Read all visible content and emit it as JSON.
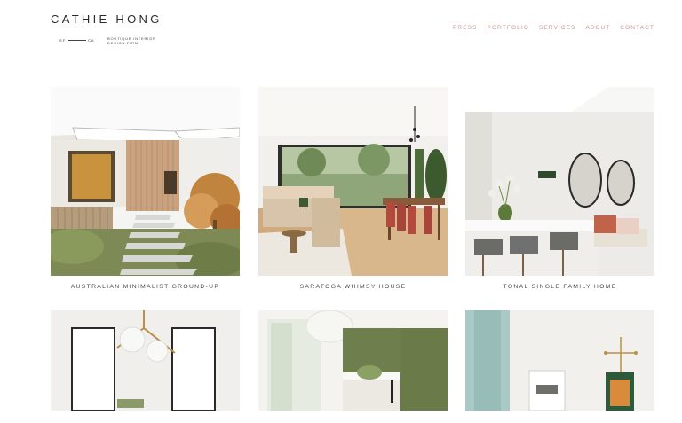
{
  "logo": {
    "name": "CATHIE HONG",
    "left": "SF",
    "right": "CA",
    "tagline_1": "BOUTIQUE INTERIOR",
    "tagline_2": "DESIGN FIRM"
  },
  "nav": {
    "items": [
      "PRESS",
      "PORTFOLIO",
      "SERVICES",
      "ABOUT",
      "CONTACT"
    ]
  },
  "projects": [
    {
      "title": "AUSTRALIAN MINIMALIST GROUND-UP"
    },
    {
      "title": "SARATOGA WHIMSY HOUSE"
    },
    {
      "title": "TONAL SINGLE FAMILY HOME"
    }
  ],
  "colors": {
    "nav": "#c9958c",
    "text": "#2a2a2a"
  }
}
